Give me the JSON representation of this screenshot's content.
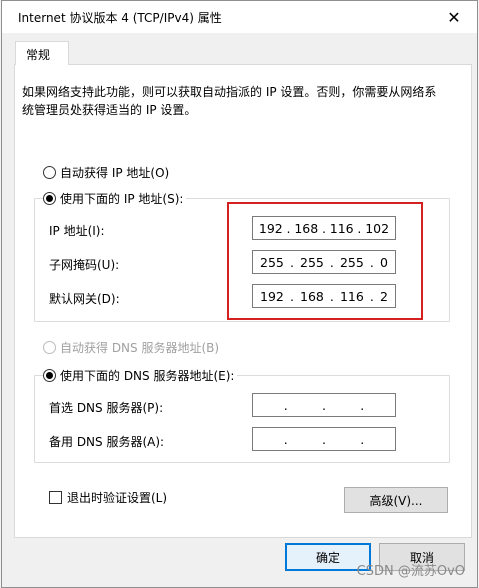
{
  "window": {
    "title": "Internet 协议版本 4 (TCP/IPv4) 属性",
    "close_label": "✕"
  },
  "tab": {
    "label": "常规"
  },
  "description": "如果网络支持此功能，则可以获取自动指派的 IP 设置。否则，你需要从网络系统管理员处获得适当的 IP 设置。",
  "ip": {
    "auto_label": "自动获得 IP 地址(O)",
    "manual_label": "使用下面的 IP 地址(S):",
    "address_label": "IP 地址(I):",
    "address": [
      "192",
      "168",
      "116",
      "102"
    ],
    "subnet_label": "子网掩码(U):",
    "subnet": [
      "255",
      "255",
      "255",
      "0"
    ],
    "gateway_label": "默认网关(D):",
    "gateway": [
      "192",
      "168",
      "116",
      "2"
    ]
  },
  "dns": {
    "auto_label": "自动获得 DNS 服务器地址(B)",
    "manual_label": "使用下面的 DNS 服务器地址(E):",
    "preferred_label": "首选 DNS 服务器(P):",
    "alternate_label": "备用 DNS 服务器(A):"
  },
  "validate_label": "退出时验证设置(L)",
  "buttons": {
    "advanced": "高级(V)...",
    "ok": "确定",
    "cancel": "取消"
  },
  "watermark": "CSDN @流苏OvO",
  "colors": {
    "highlight": "#d4201f",
    "default_button_border": "#0078d7"
  }
}
